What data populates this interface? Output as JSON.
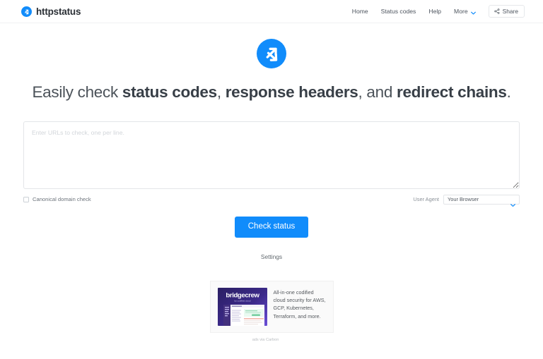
{
  "theme": {
    "accent": "#118cfb",
    "text": "#3a4049",
    "muted": "#8b9198",
    "border": "#e3e5e8",
    "ad_bg": "#fafafa"
  },
  "header": {
    "brand": {
      "name": "httpstatus",
      "logo_icon": "redirect-arrows-circle-icon"
    },
    "nav": [
      {
        "label": "Home",
        "icon": null
      },
      {
        "label": "Status codes",
        "icon": null
      },
      {
        "label": "Help",
        "icon": null
      },
      {
        "label": "More",
        "icon": "chevron-down-icon"
      }
    ],
    "share_button": {
      "label": "Share",
      "icon": "share-icon"
    }
  },
  "hero": {
    "logo_icon": "redirect-arrows-circle-icon",
    "headline": {
      "part1": "Easily check ",
      "bold1": "status codes",
      "part2": ", ",
      "bold2": "response headers",
      "part3": ", and ",
      "bold3": "redirect chains",
      "part4": "."
    }
  },
  "form": {
    "textarea": {
      "placeholder": "Enter URLs to check, one per line.",
      "value": ""
    },
    "canonical_check": {
      "label": "Canonical domain check",
      "checked": false
    },
    "user_agent": {
      "label": "User Agent",
      "value": "Your Browser",
      "caret_icon": "chevron-down-icon"
    },
    "submit_label": "Check status",
    "settings_label": "Settings"
  },
  "ad": {
    "brand": "bridgecrew",
    "brand_tagline": "by codified cloud",
    "copy": "All-in-one codified cloud security for AWS, GCP, Kubernetes, Terraform, and more.",
    "credit": "ads via Carbon"
  }
}
